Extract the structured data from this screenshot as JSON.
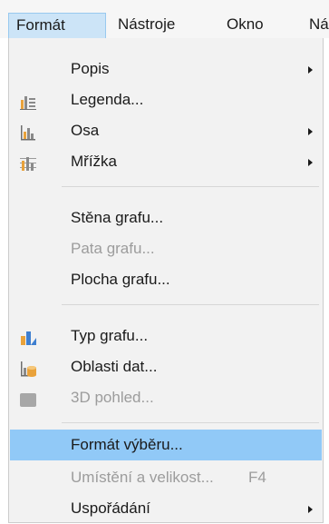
{
  "menubar": {
    "items": [
      {
        "label": "Formát",
        "underline": "F",
        "active": true
      },
      {
        "label": "Nástroje",
        "underline": "N"
      },
      {
        "label": "Okno",
        "underline": "O"
      },
      {
        "label": "Ná"
      }
    ]
  },
  "menu": {
    "items": [
      {
        "label": "Popis",
        "submenu": true,
        "enabled": true
      },
      {
        "label": "Legenda...",
        "icon": "legend-icon",
        "enabled": true
      },
      {
        "label": "Osa",
        "icon": "axis-icon",
        "submenu": true,
        "enabled": true
      },
      {
        "label": "Mřížka",
        "icon": "grid-icon",
        "submenu": true,
        "enabled": true
      },
      {
        "label": "Stěna grafu...",
        "enabled": true
      },
      {
        "label": "Pata grafu...",
        "enabled": false
      },
      {
        "label": "Plocha grafu...",
        "enabled": true
      },
      {
        "label": "Typ grafu...",
        "icon": "chart-type-icon",
        "enabled": true
      },
      {
        "label": "Oblasti dat...",
        "icon": "data-ranges-icon",
        "enabled": true
      },
      {
        "label": "3D pohled...",
        "icon": "3d-view-icon",
        "enabled": false
      },
      {
        "label": "Formát výběru...",
        "enabled": true,
        "highlighted": true
      },
      {
        "label": "Umístění a velikost...",
        "accelerator": "F4",
        "enabled": false
      },
      {
        "label": "Uspořádání",
        "submenu": true,
        "enabled": true
      }
    ]
  },
  "colors": {
    "highlight": "#91c9f7",
    "menu_bg": "#f2f2f2",
    "disabled_text": "#9c9c9c",
    "icon_orange": "#e9a23b",
    "icon_blue": "#3f7fd0"
  }
}
